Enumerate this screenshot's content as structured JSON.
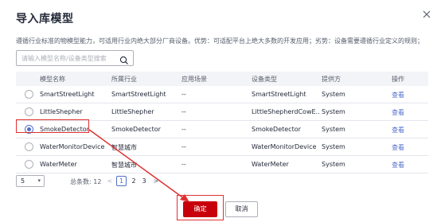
{
  "dialog": {
    "title": "导入库模型",
    "description": "遵循行业标准的物模型能力，可适用行业内绝大部分厂商设备。优势：可适配平台上绝大多数的开发应用；劣势：设备需要遵循行业定义的规则；",
    "search_placeholder": "请输入模型名称/设备类型搜索",
    "columns": [
      "模型名称",
      "所属行业",
      "应用场景",
      "设备类型",
      "提供方",
      "操作"
    ],
    "rows": [
      {
        "name": "SmartStreetLight",
        "industry": "SmartStreetLight",
        "scene": "--",
        "device_type": "SmartStreetLight",
        "provider": "System",
        "action": "查看",
        "selected": false
      },
      {
        "name": "LittleShepher",
        "industry": "LittleShepher",
        "scene": "--",
        "device_type": "LittleShepherdCowE...",
        "provider": "System",
        "action": "查看",
        "selected": false
      },
      {
        "name": "SmokeDetector",
        "industry": "SmokeDetector",
        "scene": "--",
        "device_type": "SmokeDetector",
        "provider": "System",
        "action": "查看",
        "selected": true
      },
      {
        "name": "WaterMonitorDevice",
        "industry": "智慧城市",
        "scene": "--",
        "device_type": "WaterMonitorDevice",
        "provider": "System",
        "action": "查看",
        "selected": false
      },
      {
        "name": "WaterMeter",
        "industry": "智慧城市",
        "scene": "--",
        "device_type": "WaterMeter",
        "provider": "System",
        "action": "查看",
        "selected": false
      }
    ],
    "pagination": {
      "page_size": "5",
      "total_text": "总条数: 12",
      "pages": [
        "1",
        "2",
        "3"
      ],
      "current_page": "1",
      "prev": "<",
      "next": ">"
    },
    "buttons": {
      "confirm": "确定",
      "cancel": "取消"
    },
    "colors": {
      "accent": "#526ecc",
      "primary_button": "#c7000b",
      "annotation": "#e03030"
    }
  }
}
